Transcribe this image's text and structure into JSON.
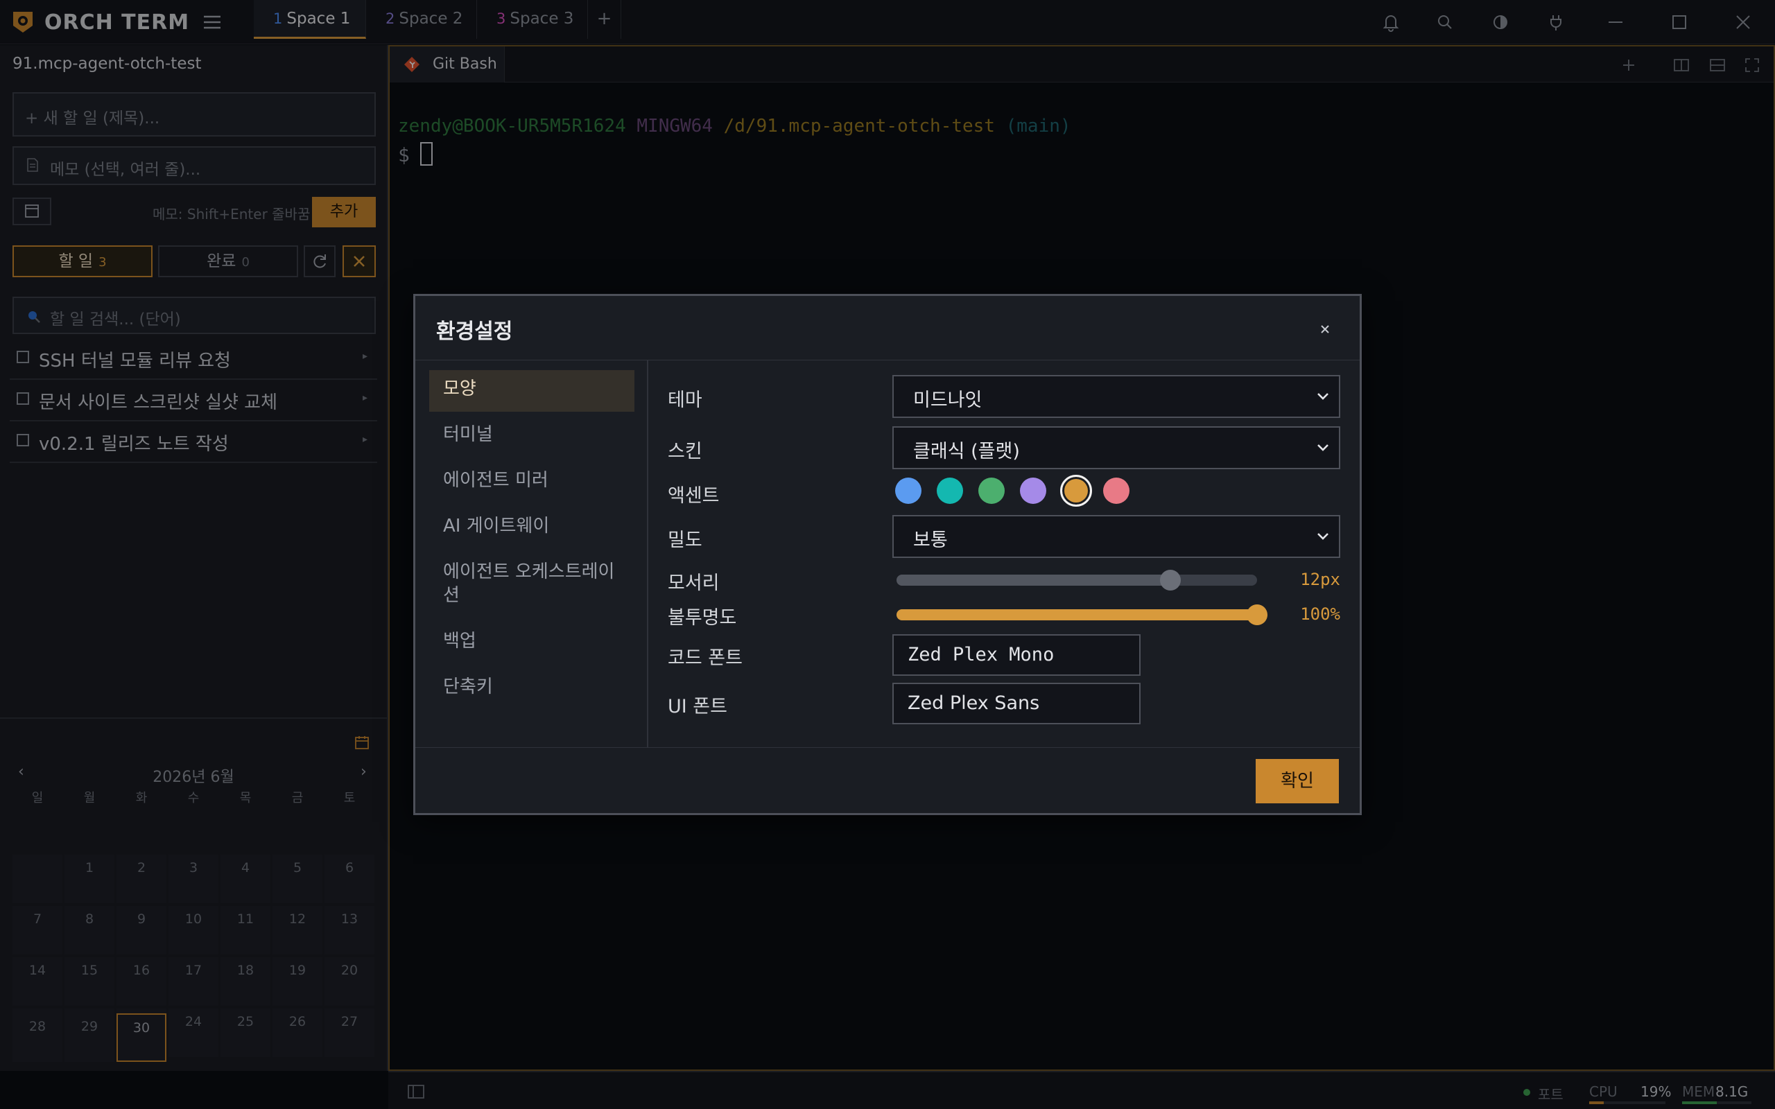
{
  "titlebar": {
    "app_name": "ORCH TERM",
    "tabs": [
      {
        "num": "1",
        "label": "Space 1",
        "num_color": "#4c8df6"
      },
      {
        "num": "2",
        "label": "Space 2",
        "num_color": "#8a7bd8"
      },
      {
        "num": "3",
        "label": "Space 3",
        "num_color": "#d94fbf"
      }
    ],
    "add_tab": "+"
  },
  "sidebar": {
    "project_name": "91.mcp-agent-otch-test",
    "todo_title_placeholder": "+ 새 할 일 (제목)...",
    "todo_memo_placeholder": "메모 (선택, 여러 줄)...",
    "memo_hint": "메모: Shift+Enter 줄바꿈",
    "add_label": "추가",
    "filters": {
      "todo_label": "할 일",
      "todo_count": "3",
      "done_label": "완료",
      "done_count": "0"
    },
    "search_placeholder": "할 일 검색... (단어)",
    "todos": [
      {
        "text": "SSH 터널 모듈 리뷰 요청"
      },
      {
        "text": "문서 사이트 스크린샷 실샷 교체"
      },
      {
        "text": "v0.2.1 릴리즈 노트 작성"
      }
    ],
    "calendar": {
      "prev": "‹",
      "next": "›",
      "month_label": "2026년 6월",
      "weekdays": [
        "일",
        "월",
        "화",
        "수",
        "목",
        "금",
        "토"
      ],
      "today": "30"
    }
  },
  "terminal": {
    "tab_label": "Git Bash",
    "prompt": {
      "user_host": "zendy@BOOK-UR5M5R1624",
      "system": "MINGW64",
      "path": "/d/91.mcp-agent-otch-test",
      "branch": "(main)"
    },
    "prompt_symbol": "$"
  },
  "statusbar": {
    "port_label": "포트",
    "cpu_label": "CPU",
    "cpu_value": "19%",
    "cpu_fraction": 0.19,
    "mem_label": "MEM",
    "mem_value": "8.1G",
    "mem_fraction": 0.5
  },
  "settings_dialog": {
    "title": "환경설정",
    "close": "×",
    "nav": [
      "모양",
      "터미널",
      "에이전트 미러",
      "AI 게이트웨이",
      "에이전트 오케스트레이션",
      "백업",
      "단축키"
    ],
    "labels": {
      "theme": "테마",
      "skin": "스킨",
      "accent": "액센트",
      "density": "밀도",
      "corner": "모서리",
      "opacity": "불투명도",
      "code_font": "코드 폰트",
      "ui_font": "UI 폰트"
    },
    "theme_value": "미드나잇",
    "skin_value": "클래식 (플랫)",
    "density_value": "보통",
    "accent_colors": [
      "#5b9bf0",
      "#14b8b0",
      "#4caf6e",
      "#a58ae8",
      "#d89a3c",
      "#e87a86"
    ],
    "accent_selected": "#d89a3c",
    "corner_value": "12px",
    "corner_fraction": 0.76,
    "opacity_value": "100%",
    "opacity_fraction": 1.0,
    "code_font_value": "Zed Plex Mono",
    "ui_font_value": "Zed Plex Sans",
    "ok_label": "확인"
  }
}
